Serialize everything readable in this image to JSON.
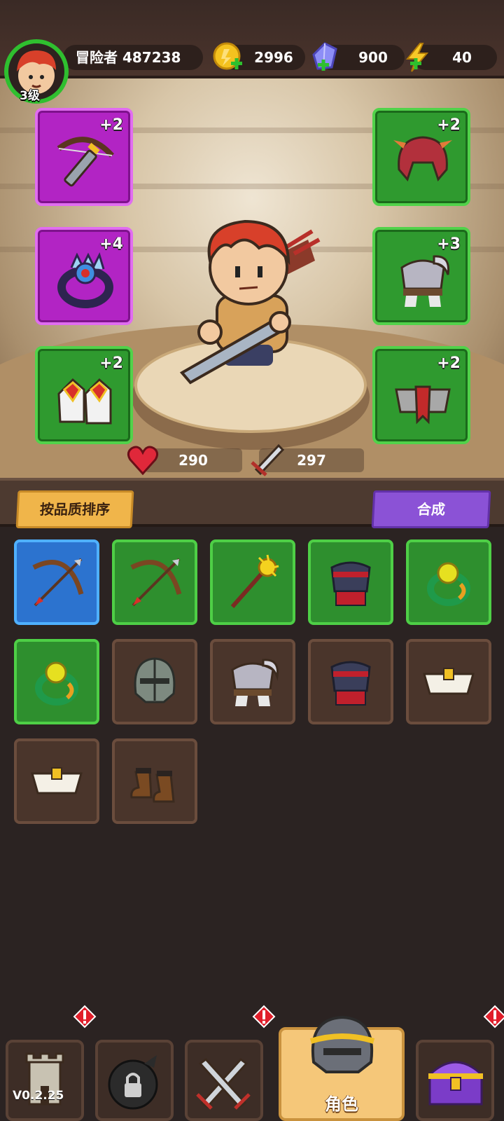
{
  "player": {
    "name": "冒险者 487238",
    "level": "3级"
  },
  "resources": {
    "gold": "2996",
    "gems": "900",
    "energy": "40"
  },
  "equipped": {
    "weapon": {
      "plus": "+2",
      "rarity": "purple",
      "icon": "crossbow-icon"
    },
    "ring": {
      "plus": "+4",
      "rarity": "purple",
      "icon": "ring-icon"
    },
    "boots": {
      "plus": "+2",
      "rarity": "green",
      "icon": "boots-icon"
    },
    "helmet": {
      "plus": "+2",
      "rarity": "green",
      "icon": "helmet-icon"
    },
    "armor": {
      "plus": "+3",
      "rarity": "green",
      "icon": "armor-icon"
    },
    "belt": {
      "plus": "+2",
      "rarity": "green",
      "icon": "belt-icon"
    }
  },
  "stats": {
    "hp": "290",
    "attack": "297"
  },
  "actions": {
    "sort_label": "按品质排序",
    "merge_label": "合成"
  },
  "inventory": [
    {
      "rarity": "blue",
      "icon": "bow-icon"
    },
    {
      "rarity": "green",
      "icon": "bow-icon"
    },
    {
      "rarity": "green",
      "icon": "staff-icon"
    },
    {
      "rarity": "green",
      "icon": "chest-armor-icon"
    },
    {
      "rarity": "green",
      "icon": "ring-icon"
    },
    {
      "rarity": "green",
      "icon": "ring-icon"
    },
    {
      "rarity": "brown",
      "icon": "knight-helmet-icon"
    },
    {
      "rarity": "brown",
      "icon": "armor-icon"
    },
    {
      "rarity": "brown",
      "icon": "chest-armor-icon"
    },
    {
      "rarity": "brown",
      "icon": "belt-icon"
    },
    {
      "rarity": "brown",
      "icon": "belt-icon"
    },
    {
      "rarity": "brown",
      "icon": "boots-icon"
    }
  ],
  "nav": {
    "version": "V0.2.25",
    "active_label": "角色",
    "items": [
      "tower-icon",
      "locked-bag-icon",
      "crossed-swords-icon",
      "helmet-icon",
      "treasure-chest-icon"
    ]
  },
  "colors": {
    "purple": "#b224c4",
    "green": "#2f9a2f",
    "blue": "#2c73cf",
    "brown": "#4a352b",
    "accent": "#f0b54a"
  }
}
